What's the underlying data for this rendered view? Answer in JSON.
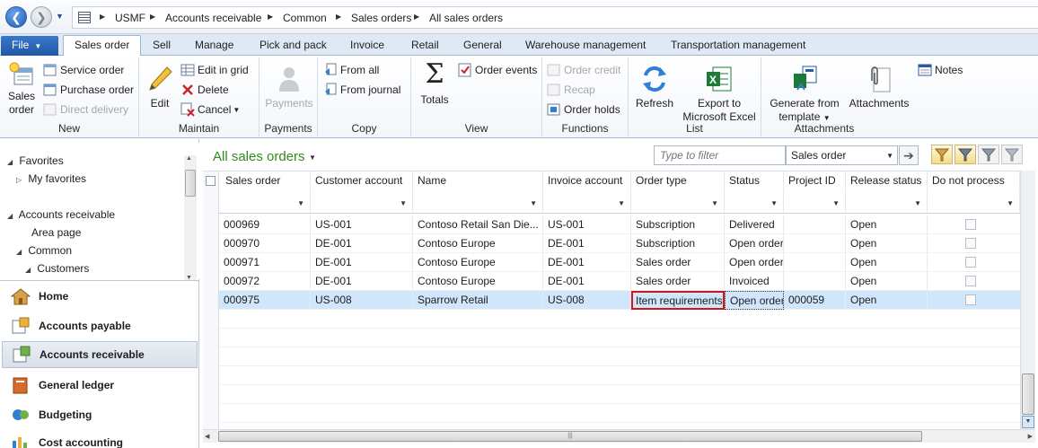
{
  "breadcrumb": [
    "USMF",
    "Accounts receivable",
    "Common",
    "Sales orders",
    "All sales orders"
  ],
  "ribbon_tabs": {
    "file": "File",
    "tabs": [
      "Sales order",
      "Sell",
      "Manage",
      "Pick and pack",
      "Invoice",
      "Retail",
      "General",
      "Warehouse management",
      "Transportation management"
    ],
    "active": "Sales order"
  },
  "ribbon": {
    "new": {
      "label": "New",
      "sales_order_line1": "Sales",
      "sales_order_line2": "order",
      "service_order": "Service order",
      "purchase_order": "Purchase order",
      "direct_delivery": "Direct delivery"
    },
    "maintain": {
      "label": "Maintain",
      "edit": "Edit",
      "edit_in_grid": "Edit in grid",
      "delete": "Delete",
      "cancel": "Cancel"
    },
    "payments": {
      "label": "Payments",
      "payments_button": "Payments"
    },
    "copy": {
      "label": "Copy",
      "from_all": "From all",
      "from_journal": "From journal"
    },
    "view": {
      "label": "View",
      "totals": "Totals",
      "order_events": "Order events"
    },
    "functions": {
      "label": "Functions",
      "order_credit": "Order credit",
      "recap": "Recap",
      "order_holds": "Order holds"
    },
    "list": {
      "label": "List",
      "refresh": "Refresh",
      "export_line1": "Export to",
      "export_line2": "Microsoft Excel"
    },
    "attachments": {
      "label": "Attachments",
      "generate_line1": "Generate from",
      "generate_line2": "template",
      "attachments_button": "Attachments",
      "notes": "Notes"
    }
  },
  "nav": {
    "favorites": "Favorites",
    "my_favorites": "My favorites",
    "accounts_receivable": "Accounts receivable",
    "area_page": "Area page",
    "common": "Common",
    "customers": "Customers",
    "modules": [
      "Home",
      "Accounts payable",
      "Accounts receivable",
      "General ledger",
      "Budgeting",
      "Cost accounting"
    ],
    "active_module": "Accounts receivable"
  },
  "list": {
    "title": "All sales orders",
    "filter_placeholder": "Type to filter",
    "filter_field": "Sales order",
    "columns": [
      "Sales order",
      "Customer account",
      "Name",
      "Invoice account",
      "Order type",
      "Status",
      "Project ID",
      "Release status",
      "Do not process"
    ],
    "rows": [
      {
        "sales_order": "000969",
        "customer_account": "US-001",
        "name": "Contoso Retail San Die...",
        "invoice_account": "US-001",
        "order_type": "Subscription",
        "status": "Delivered",
        "project_id": "",
        "release_status": "Open"
      },
      {
        "sales_order": "000970",
        "customer_account": "DE-001",
        "name": "Contoso Europe",
        "invoice_account": "DE-001",
        "order_type": "Subscription",
        "status": "Open order",
        "project_id": "",
        "release_status": "Open"
      },
      {
        "sales_order": "000971",
        "customer_account": "DE-001",
        "name": "Contoso Europe",
        "invoice_account": "DE-001",
        "order_type": "Sales order",
        "status": "Open order",
        "project_id": "",
        "release_status": "Open"
      },
      {
        "sales_order": "000972",
        "customer_account": "DE-001",
        "name": "Contoso Europe",
        "invoice_account": "DE-001",
        "order_type": "Sales order",
        "status": "Invoiced",
        "project_id": "",
        "release_status": "Open"
      },
      {
        "sales_order": "000975",
        "customer_account": "US-008",
        "name": "Sparrow Retail",
        "invoice_account": "US-008",
        "order_type": "Item requirements",
        "status": "Open order",
        "project_id": "000059",
        "release_status": "Open"
      }
    ],
    "selected_row": 4,
    "highlight_color": "#d0151d",
    "selected_row_color": "#cfe6fb"
  },
  "colors": {
    "title_green": "#2e8b1e",
    "file_tab": "#2a68b8",
    "accent": "#dfe9f5"
  }
}
